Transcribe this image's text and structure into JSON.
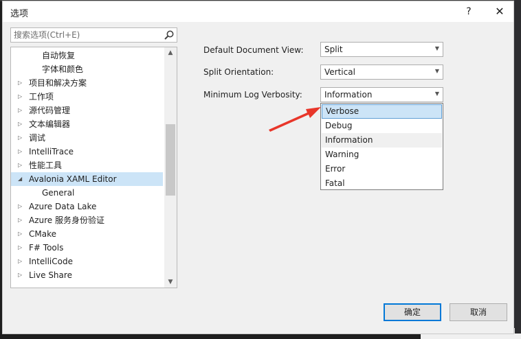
{
  "window": {
    "title": "选项",
    "help_label": "?",
    "close_label": "✕"
  },
  "search": {
    "placeholder": "搜索选项(Ctrl+E)"
  },
  "tree": {
    "items": [
      {
        "label": "自动恢复",
        "expander": ""
      },
      {
        "label": "字体和颜色",
        "expander": ""
      },
      {
        "label": "项目和解决方案",
        "expander": "▷"
      },
      {
        "label": "工作项",
        "expander": "▷"
      },
      {
        "label": "源代码管理",
        "expander": "▷"
      },
      {
        "label": "文本编辑器",
        "expander": "▷"
      },
      {
        "label": "调试",
        "expander": "▷"
      },
      {
        "label": "IntelliTrace",
        "expander": "▷"
      },
      {
        "label": "性能工具",
        "expander": "▷"
      },
      {
        "label": "Avalonia XAML Editor",
        "expander": "◢"
      },
      {
        "label": "General",
        "expander": ""
      },
      {
        "label": "Azure Data Lake",
        "expander": "▷"
      },
      {
        "label": "Azure 服务身份验证",
        "expander": "▷"
      },
      {
        "label": "CMake",
        "expander": "▷"
      },
      {
        "label": "F# Tools",
        "expander": "▷"
      },
      {
        "label": "IntelliCode",
        "expander": "▷"
      },
      {
        "label": "Live Share",
        "expander": "▷"
      }
    ],
    "selected_label": "Avalonia XAML Editor"
  },
  "settings": {
    "default_view": {
      "label": "Default Document View:",
      "value": "Split"
    },
    "split_orientation": {
      "label": "Split Orientation:",
      "value": "Vertical"
    },
    "log_verbosity": {
      "label": "Minimum Log Verbosity:",
      "value": "Information"
    }
  },
  "dropdown": {
    "options": [
      "Verbose",
      "Debug",
      "Information",
      "Warning",
      "Error",
      "Fatal"
    ],
    "hovered": "Verbose",
    "selected": "Information"
  },
  "buttons": {
    "ok": "确定",
    "cancel": "取消"
  },
  "colors": {
    "annotation_arrow": "#e8362a",
    "selection": "#cce4f7",
    "default_button_border": "#0078d7"
  },
  "icons": {
    "search": "magnifier-icon",
    "combo_arrow": "chevron-down-icon"
  }
}
